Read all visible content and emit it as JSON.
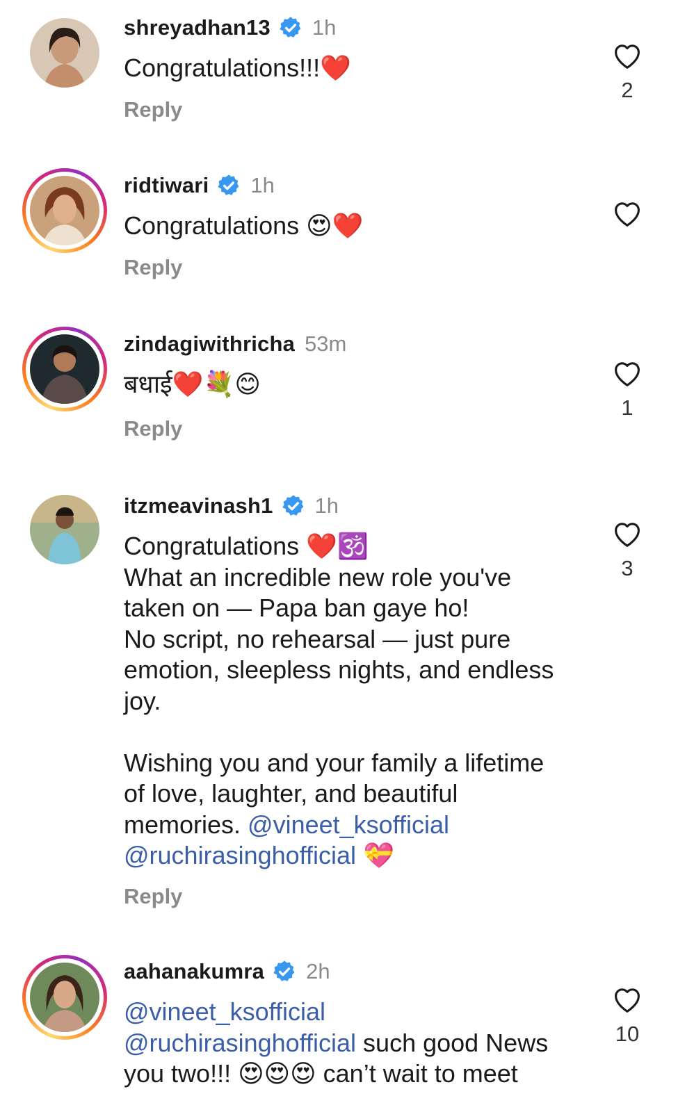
{
  "comments": [
    {
      "username": "shreyadhan13",
      "verified": true,
      "time": "1h",
      "lines": [
        "Congratulations!!!❤️"
      ],
      "reply": "Reply",
      "likes": "2",
      "avatar_story_ring": false
    },
    {
      "username": "ridtiwari",
      "verified": true,
      "time": "1h",
      "lines": [
        "Congratulations 😍❤️"
      ],
      "reply": "Reply",
      "likes": "",
      "avatar_story_ring": true
    },
    {
      "username": "zindagiwithricha",
      "verified": false,
      "time": "53m",
      "lines": [
        "बधाई❤️💐😊"
      ],
      "reply": "Reply",
      "likes": "1",
      "avatar_story_ring": true
    },
    {
      "username": "itzmeavinash1",
      "verified": true,
      "time": "1h",
      "lines": [
        "Congratulations ❤️🕉️",
        "What an incredible new role you've",
        "taken on — Papa ban gaye ho!",
        "No script, no rehearsal — just pure",
        "emotion, sleepless nights, and endless",
        "joy.",
        "",
        "Wishing you and your family a lifetime",
        "of love, laughter, and beautiful",
        "memories. ",
        ""
      ],
      "mention_1": "@vineet_ksofficial",
      "mention_2": "@ruchirasinghofficial",
      "trailing_emoji": " 💝",
      "reply": "Reply",
      "likes": "3",
      "avatar_story_ring": false
    },
    {
      "username": "aahanakumra",
      "verified": true,
      "time": "2h",
      "mention_1": "@vineet_ksofficial",
      "mention_2": "@ruchirasinghofficial",
      "text_after_mention_2": " such good News",
      "line_3": "you two!!! 😍😍😍 can’t wait to meet",
      "likes": "10",
      "avatar_story_ring": true
    }
  ],
  "colors": {
    "verified_blue": "#3897f0",
    "mention": "#3b5ea8",
    "secondary_text": "#8a8a8a"
  },
  "icons": {
    "like": "heart-outline-icon",
    "verified": "verified-badge-icon"
  }
}
